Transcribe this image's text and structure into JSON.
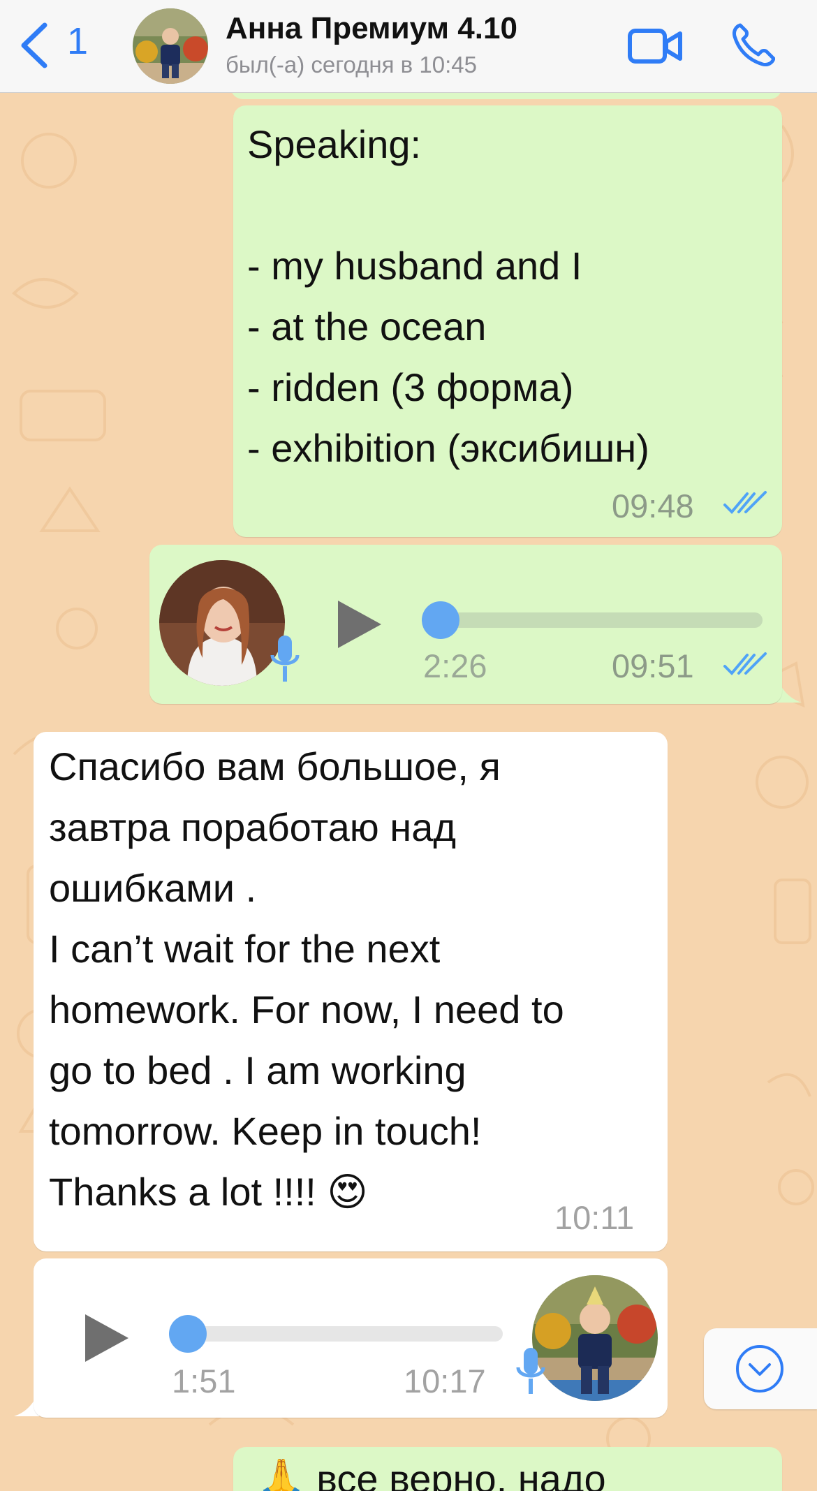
{
  "header": {
    "back_count": "1",
    "contact_name": "Анна Премиум 4.10",
    "contact_status": "был(-а) сегодня в 10:45",
    "accent_color": "#2f7cf6"
  },
  "messages": {
    "speaking": {
      "text": "Speaking:\n\n- my husband and I\n- at the ocean\n- ridden (3 форма)\n- exhibition (эксибишн)",
      "time": "09:48",
      "status": "read"
    },
    "voice_out": {
      "duration": "2:26",
      "time": "09:51",
      "progress": 0,
      "status": "read"
    },
    "thanks": {
      "text": "Спасибо вам большое, я\nзавтра поработаю над\nошибками .\nI can’t wait for the next\nhomework. For now, I need to\ngo to bed . I am working\ntomorrow. Keep in touch!\nThanks a lot !!!! 😍",
      "time": "10:11"
    },
    "voice_in": {
      "duration": "1:51",
      "time": "10:17",
      "progress": 0
    },
    "partial": {
      "text": "🙏 все верно, надо"
    }
  },
  "colors": {
    "outgoing_bubble": "#dcf8c6",
    "incoming_bubble": "#ffffff",
    "wallpaper": "#f6d5ae",
    "read_ticks": "#4fa3f7"
  },
  "icons": {
    "back": "chevron-left-icon",
    "video": "video-camera-icon",
    "call": "phone-icon",
    "play": "play-icon",
    "mic": "microphone-icon",
    "scroll": "chevron-down-circle-icon"
  }
}
